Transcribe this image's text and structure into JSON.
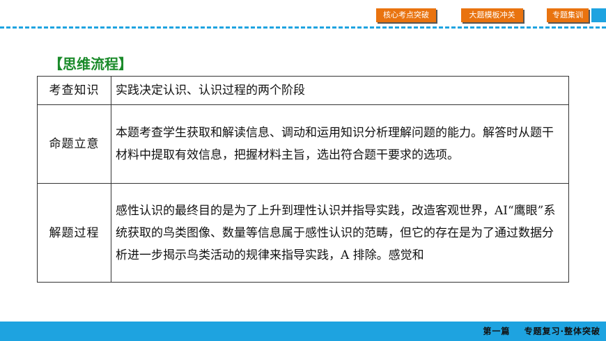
{
  "nav": {
    "items": [
      "核心考点突破",
      "大题模板冲关",
      "专题集训"
    ]
  },
  "section": {
    "title": "【思维流程】"
  },
  "table": {
    "rows": [
      {
        "label": "考查知识",
        "text": "实践决定认识、认识过程的两个阶段"
      },
      {
        "label": "命题立意",
        "text": "本题考查学生获取和解读信息、调动和运用知识分析理解问题的能力。解答时从题干材料中提取有效信息，把握材料主旨，选出符合题干要求的选项。"
      },
      {
        "label": "解题过程",
        "text": "感性认识的最终目的是为了上升到理性认识并指导实践，改造客观世界，AI“鹰眼”系统获取的鸟类图像、数量等信息属于感性认识的范畴，但它的存在是为了通过数据分析进一步揭示鸟类活动的规律来指导实践，A 排除。感觉和"
      }
    ]
  },
  "footer": {
    "part": "第一篇",
    "subtitle": "专题复习·整体突破"
  },
  "colors": {
    "accent_blue": "#1ea3e0",
    "button_orange": "#e9730f",
    "heading_green": "#1a8a2a"
  }
}
